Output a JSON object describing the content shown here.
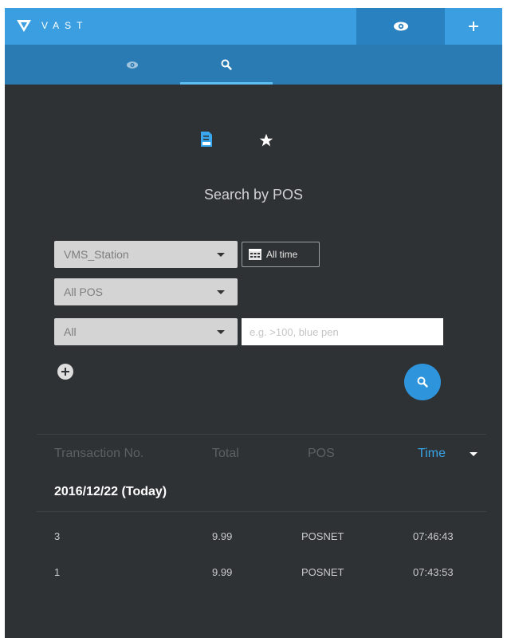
{
  "header": {
    "brand": "VAST"
  },
  "title": "Search by POS",
  "form": {
    "station_select": "VMS_Station",
    "pos_select": "All POS",
    "field_select": "All",
    "time_button": "All time",
    "keyword_placeholder": "e.g. >100, blue pen"
  },
  "table": {
    "headers": {
      "transaction_no": "Transaction No.",
      "total": "Total",
      "pos": "POS",
      "time": "Time"
    },
    "date_group": "2016/12/22 (Today)",
    "rows": [
      {
        "transaction_no": "3",
        "total": "9.99",
        "pos": "POSNET",
        "time": "07:46:43"
      },
      {
        "transaction_no": "1",
        "total": "9.99",
        "pos": "POSNET",
        "time": "07:43:53"
      }
    ]
  },
  "colors": {
    "accent": "#3b9ee0",
    "accent_dark": "#2a7bb4",
    "background": "#2f3234",
    "time_header": "#36a3e6"
  }
}
